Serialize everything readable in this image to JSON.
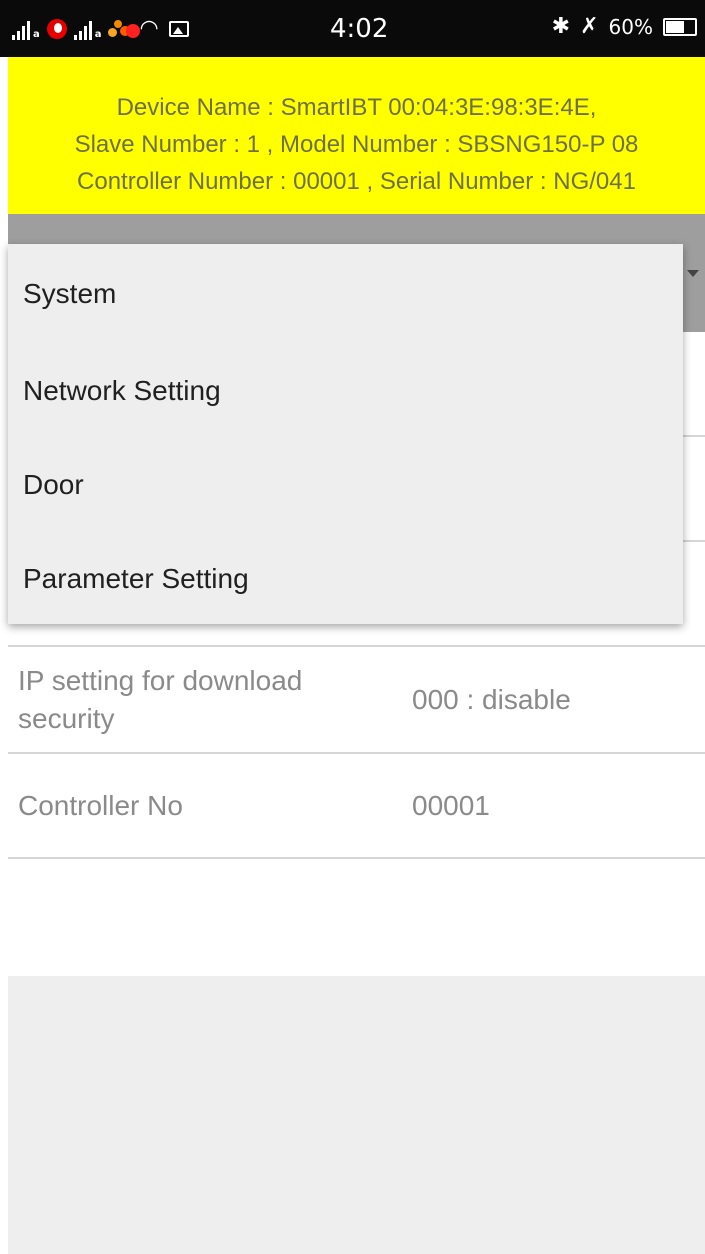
{
  "status_bar": {
    "time": "4:02",
    "battery": "60%",
    "icons": [
      "signal-icon",
      "vodafone-icon",
      "signal-icon",
      "app-dots-icon",
      "wifi-icon",
      "image-icon",
      "bluetooth-icon",
      "mute-icon",
      "battery-icon"
    ]
  },
  "header": {
    "line1": "Device Name  : SmartIBT 00:04:3E:98:3E:4E,",
    "line2": "Slave Number : 1 , Model Number :   SBSNG150-P 08",
    "line3": "Controller Number : 00001 , Serial Number : NG/041",
    "background": "#ffff00"
  },
  "dropdown": {
    "items": [
      "System",
      "Network Setting",
      "Door",
      "Parameter Setting"
    ]
  },
  "settings": [
    {
      "label": "IP setting for download security",
      "value": "000 : disable"
    },
    {
      "label": "Controller No",
      "value": "00001"
    }
  ]
}
